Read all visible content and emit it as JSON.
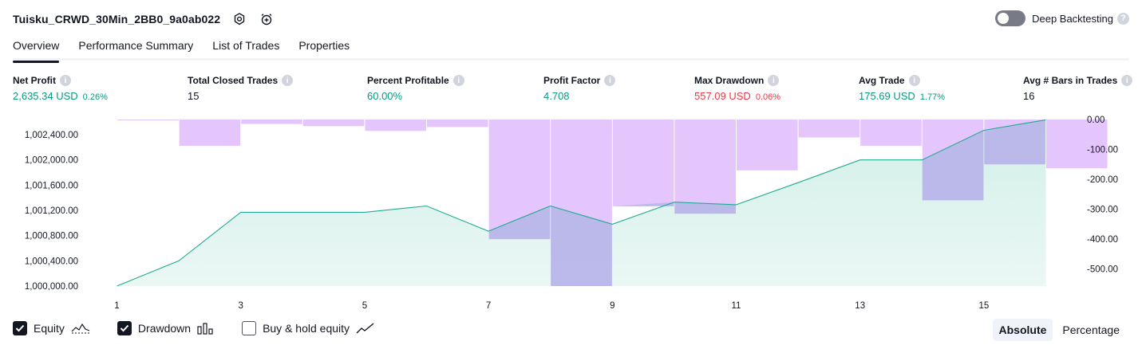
{
  "header": {
    "strategy_name": "Tuisku_CRWD_30Min_2BB0_9a0ab022",
    "deep_backtesting_label": "Deep Backtesting",
    "deep_backtesting_on": false
  },
  "tabs": [
    {
      "label": "Overview",
      "active": true
    },
    {
      "label": "Performance Summary",
      "active": false
    },
    {
      "label": "List of Trades",
      "active": false
    },
    {
      "label": "Properties",
      "active": false
    }
  ],
  "stats": {
    "net_profit": {
      "label": "Net Profit",
      "value": "2,635.34 USD",
      "pct": "0.26%"
    },
    "total_closed_trades": {
      "label": "Total Closed Trades",
      "value": "15"
    },
    "percent_profitable": {
      "label": "Percent Profitable",
      "value": "60.00%"
    },
    "profit_factor": {
      "label": "Profit Factor",
      "value": "4.708"
    },
    "max_drawdown": {
      "label": "Max Drawdown",
      "value": "557.09 USD",
      "pct": "0.06%"
    },
    "avg_trade": {
      "label": "Avg Trade",
      "value": "175.69 USD",
      "pct": "1.77%"
    },
    "avg_bars": {
      "label": "Avg # Bars in Trades",
      "value": "16"
    }
  },
  "legend": {
    "equity": {
      "label": "Equity",
      "checked": true
    },
    "drawdown": {
      "label": "Drawdown",
      "checked": true
    },
    "buy_hold": {
      "label": "Buy & hold equity",
      "checked": false
    }
  },
  "mode": {
    "absolute_label": "Absolute",
    "percentage_label": "Percentage",
    "selected": "Absolute"
  },
  "colors": {
    "equity_line": "#22ab94",
    "equity_fill": "#d2efe8",
    "drawdown_fill": "#e1bffc",
    "overlap_fill": "#b4b7e6",
    "positive": "#089981",
    "negative": "#f23645"
  },
  "chart_data": {
    "type": "area",
    "x_tick_labels": [
      "1",
      "3",
      "5",
      "7",
      "9",
      "11",
      "13",
      "15"
    ],
    "x": [
      1,
      2,
      3,
      4,
      5,
      6,
      7,
      8,
      9,
      10,
      11,
      12,
      13,
      14,
      15,
      16
    ],
    "equity": {
      "name": "Equity",
      "values": [
        1000000,
        1000400,
        1001170,
        1001170,
        1001170,
        1001270,
        1000870,
        1001270,
        1000980,
        1001330,
        1001290,
        1001640,
        1002000,
        1002000,
        1002470,
        1002635.34
      ]
    },
    "drawdown": {
      "name": "Drawdown",
      "values": [
        -2,
        -88,
        -15,
        -22,
        -38,
        -25,
        -400,
        -557.09,
        -290,
        -315,
        -170,
        -60,
        -88,
        -270,
        -150,
        -163
      ]
    },
    "left_axis": {
      "ylim": [
        1000000,
        1002640
      ],
      "ticks": [
        "1,000,000.00",
        "1,000,400.00",
        "1,000,800.00",
        "1,001,200.00",
        "1,001,600.00",
        "1,002,000.00",
        "1,002,400.00"
      ]
    },
    "right_axis": {
      "ylim": [
        -557.09,
        0
      ],
      "ticks": [
        "0.00",
        "-100.00",
        "-200.00",
        "-300.00",
        "-400.00",
        "-500.00"
      ]
    },
    "grid": false
  }
}
